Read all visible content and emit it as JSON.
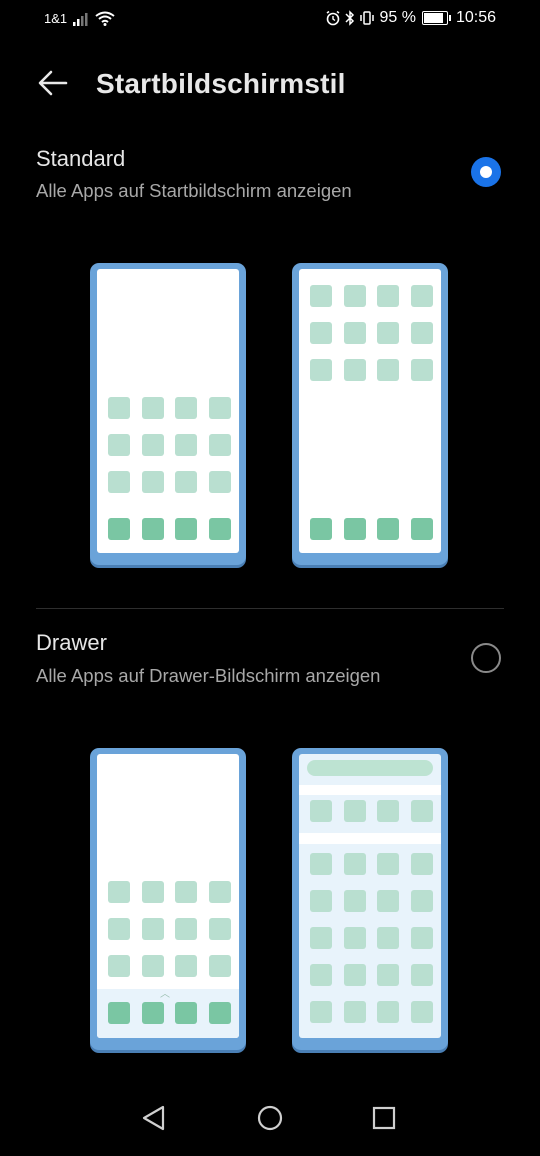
{
  "status_bar": {
    "carrier": "1&1",
    "battery_text": "95 %",
    "battery_level": 0.95,
    "time": "10:56"
  },
  "header": {
    "title": "Startbildschirmstil"
  },
  "options": [
    {
      "title": "Standard",
      "subtitle": "Alle Apps auf Startbildschirm anzeigen",
      "selected": true
    },
    {
      "title": "Drawer",
      "subtitle": "Alle Apps auf Drawer-Bildschirm anzeigen",
      "selected": false
    }
  ],
  "colors": {
    "accent": "#1a73e8",
    "phone_frame": "#6aa3d9",
    "icon_light": "#b9dfd0",
    "icon_dark": "#7ac6a3"
  },
  "icons": {
    "back": "arrow-left-icon",
    "nav_back": "triangle-back-icon",
    "nav_home": "circle-home-icon",
    "nav_recent": "square-recent-icon"
  }
}
